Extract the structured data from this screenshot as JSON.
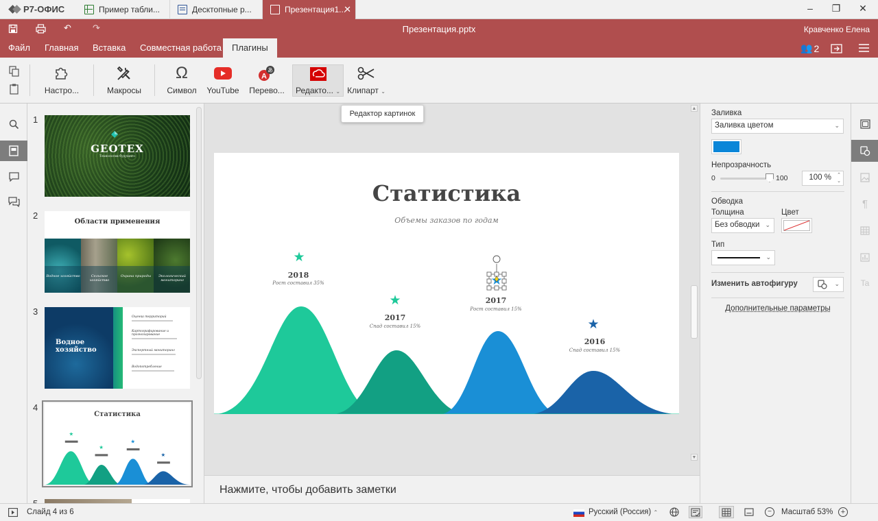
{
  "app": {
    "brand": "Р7-ОФИС"
  },
  "doc_tabs": [
    {
      "label": "Пример табли..."
    },
    {
      "label": "Десктопные р..."
    },
    {
      "label": "Презентация1..."
    }
  ],
  "titlebar": {
    "title": "Презентация.pptx",
    "user": "Кравченко Елена",
    "coauthors_count": "2"
  },
  "menu": [
    "Файл",
    "Главная",
    "Вставка",
    "Совместная работа",
    "Плагины"
  ],
  "menu_active": "Плагины",
  "toolbar": {
    "buttons": [
      {
        "label": "Настро...",
        "icon": "puzzle-icon"
      },
      {
        "label": "Макросы",
        "icon": "tools-icon"
      },
      {
        "label": "Символ",
        "icon": "omega-icon"
      },
      {
        "label": "YouTube",
        "icon": "youtube-icon"
      },
      {
        "label": "Перево...",
        "icon": "translator-icon"
      },
      {
        "label": "Редакто...",
        "icon": "image-editor-icon"
      },
      {
        "label": "Клипарт",
        "icon": "scissors-icon"
      }
    ],
    "tooltip": "Редактор картинок"
  },
  "thumbs": {
    "numbers": [
      "1",
      "2",
      "3",
      "4",
      "5"
    ],
    "t1": {
      "title": "GEOTEX",
      "subtitle": "Технологии будущего"
    },
    "t2": {
      "title": "Области применения",
      "captions": [
        "Водное хозяйство",
        "Сельское хозяйство",
        "Охрана природы",
        "Экологический мониторинг"
      ]
    },
    "t3": {
      "title": "Водное хозяйство",
      "items": [
        "Оценка территорий",
        "Картографирование и прогнозирование",
        "Экспертный мониторинг",
        "Водопотребление"
      ]
    },
    "t4": {
      "title": "Статистика"
    }
  },
  "slide": {
    "title": "Статистика",
    "subtitle": "Объемы заказов по годам",
    "points": [
      {
        "year": "2018",
        "note": "Рост составил 35%"
      },
      {
        "year": "2017",
        "note": "Спад составил 15%"
      },
      {
        "year": "2017",
        "note": "Рост составил 15%"
      },
      {
        "year": "2016",
        "note": "Спад составил  15%"
      }
    ]
  },
  "notes": {
    "placeholder": "Нажмите, чтобы добавить заметки"
  },
  "right_panel": {
    "fill_label": "Заливка",
    "fill_type": "Заливка цветом",
    "fill_color": "#0a86d8",
    "opacity_label": "Непрозрачность",
    "opacity_min": "0",
    "opacity_max": "100",
    "opacity_value": "100 %",
    "stroke_label": "Обводка",
    "thickness_label": "Толщина",
    "thickness_value": "Без обводки",
    "color_label": "Цвет",
    "type_label": "Тип",
    "change_shape_label": "Изменить автофигуру",
    "advanced_link": "Дополнительные параметры"
  },
  "status": {
    "slide_info": "Слайд 4 из 6",
    "language": "Русский (Россия)",
    "zoom": "Масштаб 53%"
  },
  "colors": {
    "accent": "#b04e4e",
    "teal": "#1ec99a",
    "teal_dark": "#12a083",
    "blue": "#1a8fd6",
    "navy": "#1a63a8"
  }
}
